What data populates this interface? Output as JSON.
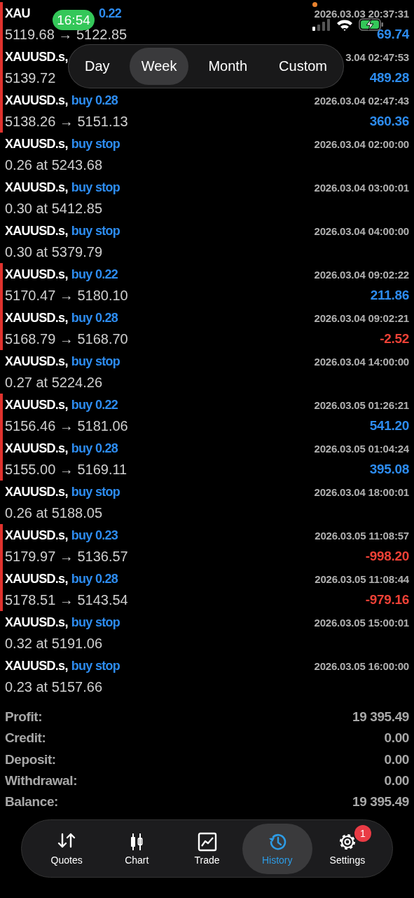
{
  "status_bar": {
    "time": "16:54"
  },
  "period_tabs": [
    {
      "label": "Day",
      "selected": false
    },
    {
      "label": "Week",
      "selected": true
    },
    {
      "label": "Month",
      "selected": false
    },
    {
      "label": "Custom",
      "selected": false
    }
  ],
  "history": [
    {
      "kind": "deal",
      "symbol": "XAU",
      "covered": true,
      "side": "0.22",
      "time": "2026.03.03 20:37:31",
      "prices": "5119.68 → 5122.85",
      "profit": "69.74",
      "loss": false
    },
    {
      "kind": "deal",
      "symbol": "XAUUSD.s,",
      "time": "3.04 02:47:53",
      "prices": "5139.72",
      "profit": "489.28",
      "loss": false
    },
    {
      "kind": "deal",
      "symbol": "XAUUSD.s,",
      "side": "buy 0.28",
      "time": "2026.03.04 02:47:43",
      "prices": "5138.26 → 5151.13",
      "profit": "360.36",
      "loss": false
    },
    {
      "kind": "order",
      "symbol": "XAUUSD.s,",
      "side": "buy stop",
      "time": "2026.03.04 02:00:00",
      "prices": "0.26 at 5243.68"
    },
    {
      "kind": "order",
      "symbol": "XAUUSD.s,",
      "side": "buy stop",
      "time": "2026.03.04 03:00:01",
      "prices": "0.30 at 5412.85"
    },
    {
      "kind": "order",
      "symbol": "XAUUSD.s,",
      "side": "buy stop",
      "time": "2026.03.04 04:00:00",
      "prices": "0.30 at 5379.79"
    },
    {
      "kind": "deal",
      "symbol": "XAUUSD.s,",
      "side": "buy 0.22",
      "time": "2026.03.04 09:02:22",
      "prices": "5170.47 → 5180.10",
      "profit": "211.86",
      "loss": false
    },
    {
      "kind": "deal",
      "symbol": "XAUUSD.s,",
      "side": "buy 0.28",
      "time": "2026.03.04 09:02:21",
      "prices": "5168.79 → 5168.70",
      "profit": "-2.52",
      "loss": true
    },
    {
      "kind": "order",
      "symbol": "XAUUSD.s,",
      "side": "buy stop",
      "time": "2026.03.04 14:00:00",
      "prices": "0.27 at 5224.26"
    },
    {
      "kind": "deal",
      "symbol": "XAUUSD.s,",
      "side": "buy 0.22",
      "time": "2026.03.05 01:26:21",
      "prices": "5156.46 → 5181.06",
      "profit": "541.20",
      "loss": false
    },
    {
      "kind": "deal",
      "symbol": "XAUUSD.s,",
      "side": "buy 0.28",
      "time": "2026.03.05 01:04:24",
      "prices": "5155.00 → 5169.11",
      "profit": "395.08",
      "loss": false
    },
    {
      "kind": "order",
      "symbol": "XAUUSD.s,",
      "side": "buy stop",
      "time": "2026.03.04 18:00:01",
      "prices": "0.26 at 5188.05"
    },
    {
      "kind": "deal",
      "symbol": "XAUUSD.s,",
      "side": "buy 0.23",
      "time": "2026.03.05 11:08:57",
      "prices": "5179.97 → 5136.57",
      "profit": "-998.20",
      "loss": true
    },
    {
      "kind": "deal",
      "symbol": "XAUUSD.s,",
      "side": "buy 0.28",
      "time": "2026.03.05 11:08:44",
      "prices": "5178.51 → 5143.54",
      "profit": "-979.16",
      "loss": true
    },
    {
      "kind": "order",
      "symbol": "XAUUSD.s,",
      "side": "buy stop",
      "time": "2026.03.05 15:00:01",
      "prices": "0.32 at 5191.06"
    },
    {
      "kind": "order",
      "symbol": "XAUUSD.s,",
      "side": "buy stop",
      "time": "2026.03.05 16:00:00",
      "prices": "0.23 at 5157.66"
    }
  ],
  "summary": [
    {
      "label": "Profit:",
      "value": "19 395.49"
    },
    {
      "label": "Credit:",
      "value": "0.00"
    },
    {
      "label": "Deposit:",
      "value": "0.00"
    },
    {
      "label": "Withdrawal:",
      "value": "0.00"
    },
    {
      "label": "Balance:",
      "value": "19 395.49"
    }
  ],
  "tab_bar": [
    {
      "kind": "quotes",
      "label": "Quotes",
      "selected": false
    },
    {
      "kind": "chart",
      "label": "Chart",
      "selected": false
    },
    {
      "kind": "trade",
      "label": "Trade",
      "selected": false
    },
    {
      "kind": "history",
      "label": "History",
      "selected": true
    },
    {
      "kind": "settings",
      "label": "Settings",
      "selected": false,
      "badge": "1"
    }
  ]
}
